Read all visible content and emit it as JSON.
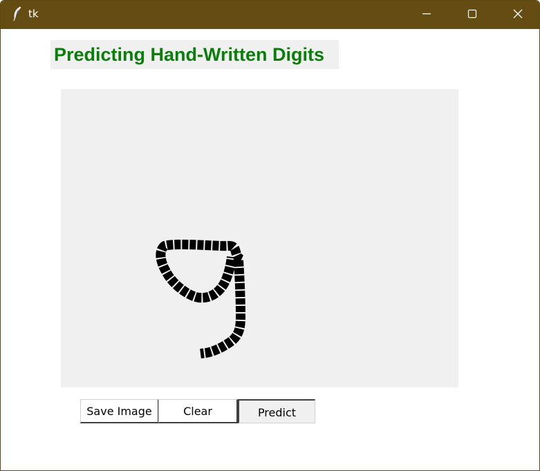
{
  "window": {
    "title": "tk",
    "titlebar_color": "#654c12",
    "controls": [
      "minimize-icon",
      "maximize-icon",
      "close-icon"
    ]
  },
  "heading": {
    "text": "Predicting Hand-Written Digits",
    "color": "#0a7d0a"
  },
  "canvas": {
    "background": "#f0f0f0",
    "stroke_color": "#000000"
  },
  "buttons": {
    "save_label": "Save Image",
    "clear_label": "Clear",
    "predict_label": "Predict",
    "pressed": "Predict"
  }
}
